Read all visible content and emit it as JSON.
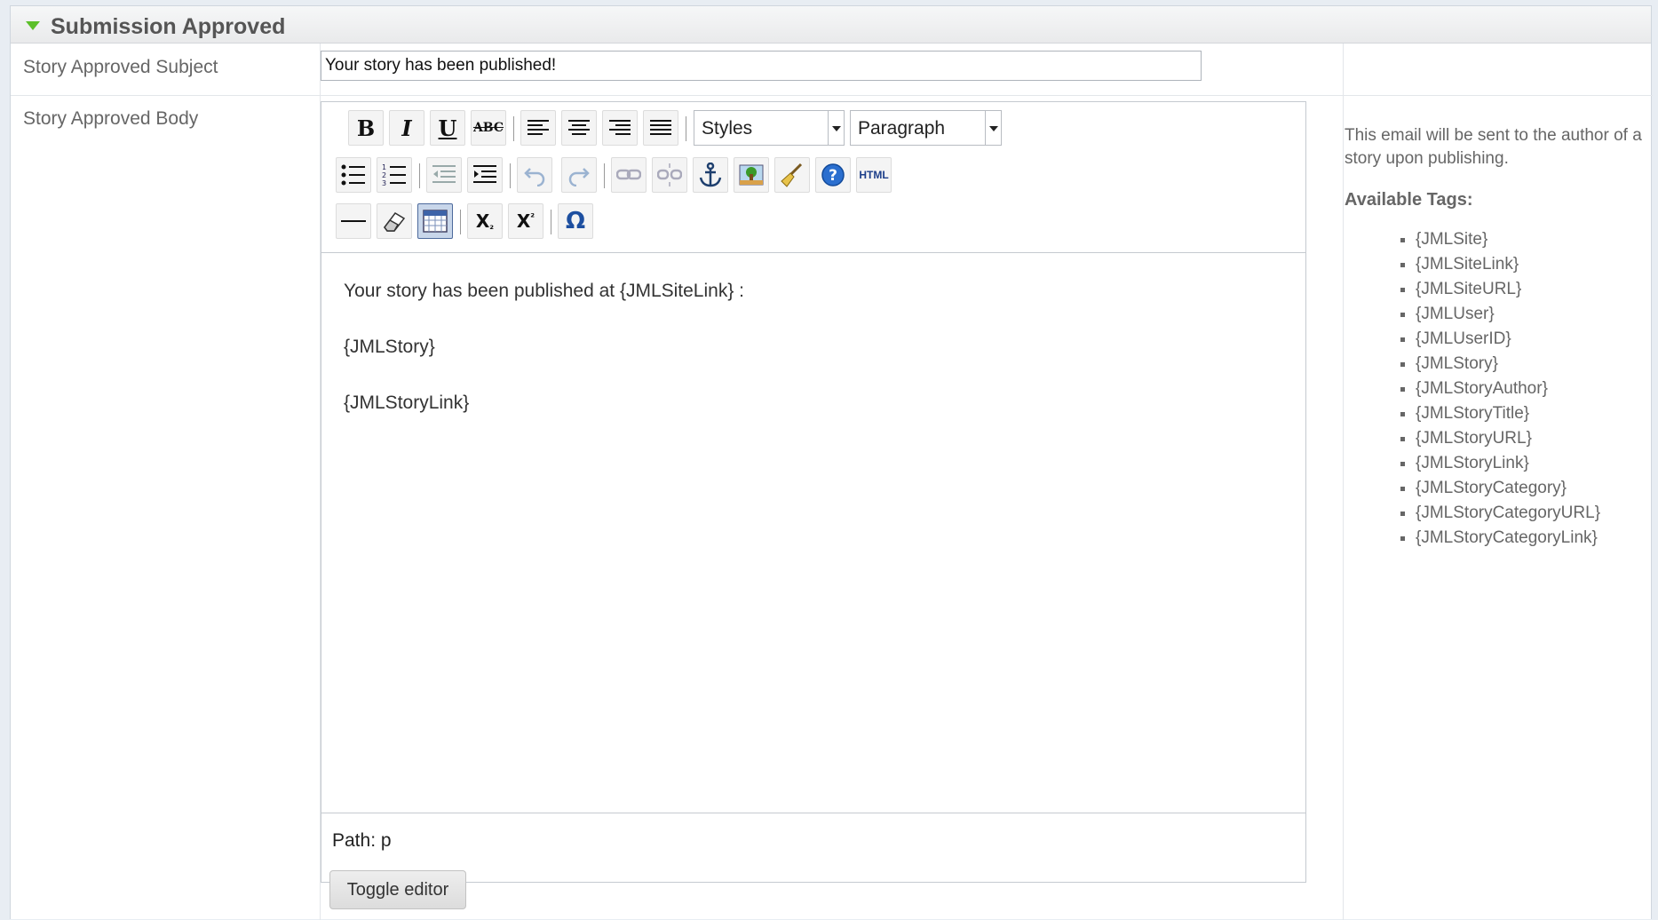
{
  "section": {
    "title": "Submission Approved"
  },
  "fields": {
    "subject_label": "Story Approved Subject",
    "subject_value": "Your story has been published!",
    "body_label": "Story Approved Body"
  },
  "editor": {
    "styles_dropdown": "Styles",
    "format_dropdown": "Paragraph",
    "html_button": "HTML",
    "content_lines": [
      "Your story has been published at {JMLSiteLink} :",
      "{JMLStory}",
      "{JMLStoryLink}"
    ],
    "path_text": "Path: p",
    "toggle_label": "Toggle editor"
  },
  "help": {
    "description": "This email will be sent to the author of a story upon publishing.",
    "tags_title": "Available Tags:",
    "tags": [
      "{JMLSite}",
      "{JMLSiteLink}",
      "{JMLSiteURL}",
      "{JMLUser}",
      "{JMLUserID}",
      "{JMLStory}",
      "{JMLStoryAuthor}",
      "{JMLStoryTitle}",
      "{JMLStoryURL}",
      "{JMLStoryLink}",
      "{JMLStoryCategory}",
      "{JMLStoryCategoryURL}",
      "{JMLStoryCategoryLink}"
    ]
  }
}
